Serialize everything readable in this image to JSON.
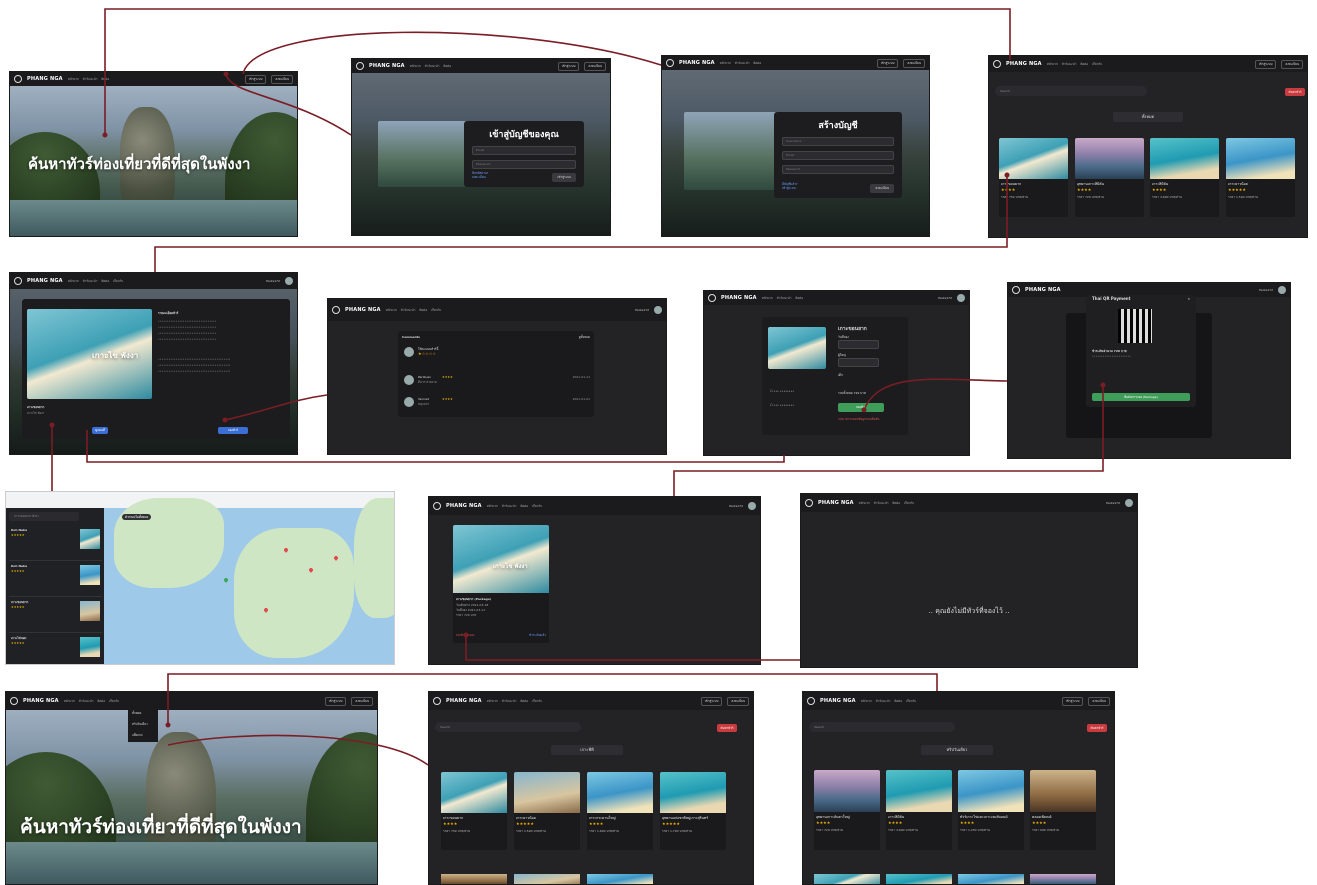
{
  "brand": {
    "name": "PHANG NGA",
    "sub": "CITY TOUR"
  },
  "nav": {
    "links": [
      "หน้าแรก",
      "ทัวร์แนะนำ",
      "ติดต่อ",
      "เกี่ยวกับ"
    ],
    "login": "เข้าสู่ระบบ",
    "register": "ลงทะเบียน",
    "user_a": "Parks172",
    "user_b": "Parks172"
  },
  "hero": {
    "title": "ค้นหาทัวร์ท่องเที่ยวที่ดีที่สุดในพังงา"
  },
  "login_modal": {
    "title": "เข้าสู่บัญชีของคุณ",
    "email": "Email",
    "password": "Password",
    "link1": "ลืมรหัสผ่าน?",
    "link2": "ลงทะเบียน",
    "submit": "เข้าสู่ระบบ"
  },
  "register_modal": {
    "title": "สร้างบัญชี",
    "username": "Username",
    "email": "Email",
    "password": "Password",
    "link1": "มีบัญชีแล้ว?",
    "link2": "เข้าสู่ระบบ",
    "submit": "ลงทะเบียน"
  },
  "listing": {
    "search": "Search",
    "search_btn": "ค้นหาทัวร์",
    "filter_all": "ทั้งหมด",
    "filter_island": "เกาะพีพี",
    "filter_beach": "ทริปวันเดียว"
  },
  "cards_all": [
    {
      "title": "เกาะขอนยาก",
      "stars": "★★★★",
      "price": "ราคา 759 บาท/ท่าน"
    },
    {
      "title": "อุทยานเกาะสิมิลัน",
      "stars": "★★★★",
      "price": "ราคา 729 บาท/ท่าน"
    },
    {
      "title": "เกาะสิมิลัน",
      "stars": "★★★★",
      "price": "ราคา 3,690 บาท/ท่าน"
    },
    {
      "title": "เกาะยาวน้อย",
      "stars": "★★★★★",
      "price": "ราคา 1,590 บาท/ท่าน"
    }
  ],
  "detail": {
    "image_text": "เกาะไข พังงา",
    "heading": "รายละเอียดทัวร์",
    "name": "เกาะขอนยาก",
    "short": "เกาะไข พังงา",
    "book": "จองทัวร์",
    "view_map": "ดูแผนที่"
  },
  "comments": {
    "title": "Comments",
    "all": "ดูทั้งหมด",
    "prompt": "ให้คะแนนทัวร์นี้",
    "rows": [
      {
        "name": "Paribuan",
        "stars": "★★★★",
        "date": "2021-01-11",
        "text": "ดีมาก สวยงาม"
      },
      {
        "name": "Yanniet",
        "stars": "★★★★",
        "date": "2021-01-01",
        "text": "สนุกมาก"
      }
    ]
  },
  "booking": {
    "title": "เกาะขอนยาก",
    "date_label": "วันที่จอง",
    "adult_label": "ผู้ใหญ่",
    "child_label": "เด็ก",
    "summary": "รวมทั้งหมด 729 บาท",
    "submit": "จองทัวร์",
    "note": "กรุณาตรวจสอบข้อมูลก่อนยืนยัน"
  },
  "payment": {
    "title": "Thai QR Payment",
    "amount": "ชำระเงินจำนวน 729 บาท",
    "confirm": "ยืนยันการจอง (Package)"
  },
  "my_booking": {
    "title": "เกาะขอนยาก (Package)",
    "date": "วันเดินทาง 2021-03-18",
    "book_date": "วันที่จอง 2021-03-11",
    "price": "ราคา 729 บาท",
    "cancel": "ยกเลิกการจอง",
    "status": "ชำระเงินแล้ว"
  },
  "empty": {
    "message": ".. คุณยังไม่มีทัวร์ที่จองไว้ .."
  },
  "dropdown": {
    "items": [
      "ทั้งหมด",
      "ทริปวันเดียว",
      "แพ็คเกจ"
    ]
  },
  "cards_island": [
    {
      "title": "เกาะขอนยาก",
      "stars": "★★★★",
      "price": "ราคา 759 บาท/ท่าน"
    },
    {
      "title": "เกาะยาวน้อย",
      "stars": "★★★★★",
      "price": "ราคา 1,590 บาท/ท่าน"
    },
    {
      "title": "เกาะกระดานใหญ่",
      "stars": "★★★★",
      "price": "ราคา 1,690 บาท/ท่าน"
    },
    {
      "title": "อุทยานแห่งชาติหมู่เกาะสุรินทร์",
      "stars": "★★★★★",
      "price": "ราคา 1,790 บาท/ท่าน"
    }
  ],
  "cards_beach": [
    {
      "title": "อุทยานเกาะลันตาใหญ่",
      "stars": "★★★★",
      "price": "ราคา 729 บาท/ท่าน"
    },
    {
      "title": "เกาะสิมิลัน",
      "stars": "★★★★",
      "price": "ราคา 3,690 บาท/ท่าน"
    },
    {
      "title": "ทัวร์เกาะไข่และเกาะเจมส์บอนด์",
      "stars": "★★★★",
      "price": "ราคา 1,250 บาท/ท่าน"
    },
    {
      "title": "คลองเพ้ลเบย์",
      "stars": "★★★★",
      "price": "ราคา 990 บาท/ท่าน"
    }
  ],
  "map_panel": {
    "search": "เกาะขอนยาก พังงา",
    "filter": "ตัวกรองในทั้งหมด",
    "results": [
      {
        "name": "Koh Naka",
        "stars": "★★★★★"
      },
      {
        "name": "Koh Naka",
        "stars": "★★★★★"
      },
      {
        "name": "เกาะขอนยาก",
        "stars": "★★★★★"
      },
      {
        "name": "เกาะไข่นอก",
        "stars": "★★★★★"
      }
    ]
  },
  "colors": {
    "bg": "#232325",
    "nav": "#1b1b1d",
    "accent_red": "#c93b3f",
    "link_blue": "#6fa0ff",
    "connector": "#7a1d24"
  }
}
